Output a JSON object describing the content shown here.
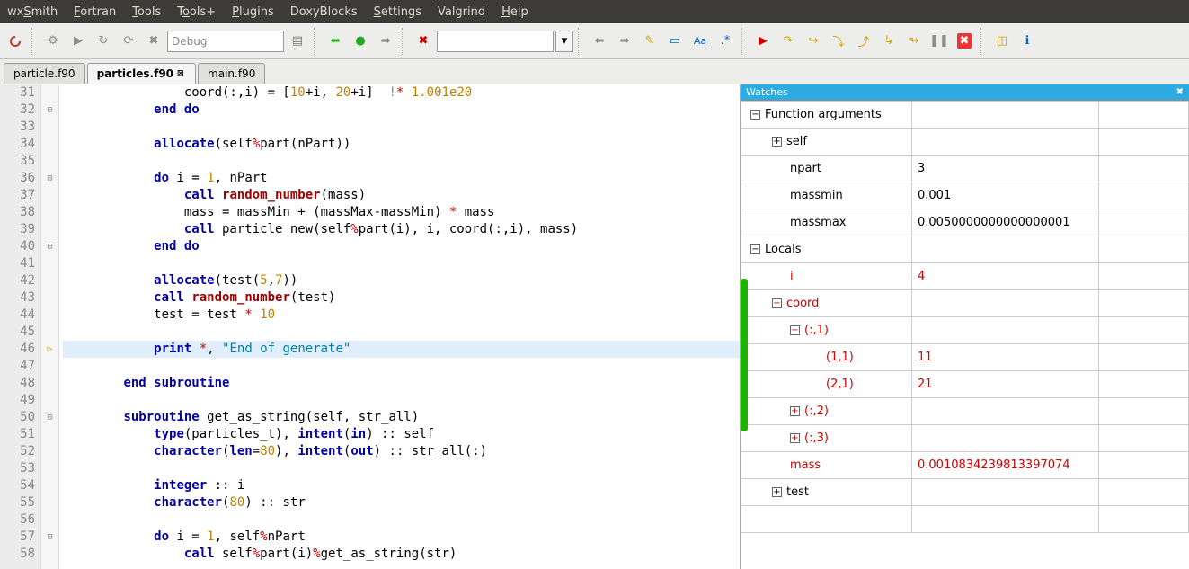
{
  "menu": [
    "wxSmith",
    "Fortran",
    "Tools",
    "Tools+",
    "Plugins",
    "DoxyBlocks",
    "Settings",
    "Valgrind",
    "Help"
  ],
  "menu_u": [
    2,
    0,
    0,
    1,
    0,
    -1,
    0,
    -1,
    0
  ],
  "toolbar": {
    "debug_config": "Debug"
  },
  "tabs": [
    {
      "label": "particle.f90",
      "active": false,
      "closable": false
    },
    {
      "label": "particles.f90",
      "active": true,
      "closable": true
    },
    {
      "label": "main.f90",
      "active": false,
      "closable": false
    }
  ],
  "editor": {
    "first_line": 31,
    "current_line": 46,
    "fold": {
      "32": "⊟",
      "36": "⊟",
      "40": "⊟",
      "50": "⊟",
      "57": "⊟",
      "46": "▷"
    },
    "lines": [
      "                coord(:,i) = [10+i, 20+i]  !* 1.001e20",
      "            end do",
      "",
      "            allocate(self%part(nPart))",
      "",
      "            do i = 1, nPart",
      "                call random_number(mass)",
      "                mass = massMin + (massMax-massMin) * mass",
      "                call particle_new(self%part(i), i, coord(:,i), mass)",
      "            end do",
      "",
      "            allocate(test(5,7))",
      "            call random_number(test)",
      "            test = test * 10",
      "",
      "            print *, \"End of generate\"",
      "",
      "        end subroutine",
      "",
      "        subroutine get_as_string(self, str_all)",
      "            type(particles_t), intent(in) :: self",
      "            character(len=80), intent(out) :: str_all(:)",
      "",
      "            integer :: i",
      "            character(80) :: str",
      "",
      "            do i = 1, self%nPart",
      "                call self%part(i)%get_as_string(str)"
    ]
  },
  "watches": {
    "title": "Watches",
    "rows": [
      {
        "exp": "-",
        "name": "Function arguments",
        "val": "",
        "ind": 0,
        "red": false
      },
      {
        "exp": "+",
        "name": "self",
        "val": "",
        "ind": 1,
        "red": false
      },
      {
        "exp": "",
        "name": "npart",
        "val": "3",
        "ind": 2,
        "red": false
      },
      {
        "exp": "",
        "name": "massmin",
        "val": "0.001",
        "ind": 2,
        "red": false
      },
      {
        "exp": "",
        "name": "massmax",
        "val": "0.0050000000000000001",
        "ind": 2,
        "red": false
      },
      {
        "exp": "-",
        "name": "Locals",
        "val": "",
        "ind": 0,
        "red": false
      },
      {
        "exp": "",
        "name": "i",
        "val": "4",
        "ind": 2,
        "red": true
      },
      {
        "exp": "-",
        "name": "coord",
        "val": "",
        "ind": 1,
        "red": true
      },
      {
        "exp": "-",
        "name": "(:,1)",
        "val": "",
        "ind": 2,
        "red": true
      },
      {
        "exp": "",
        "name": "(1,1)",
        "val": "11",
        "ind": 4,
        "red": true
      },
      {
        "exp": "",
        "name": "(2,1)",
        "val": "21",
        "ind": 4,
        "red": true
      },
      {
        "exp": "+",
        "name": "(:,2)",
        "val": "",
        "ind": 2,
        "red": true
      },
      {
        "exp": "+",
        "name": "(:,3)",
        "val": "",
        "ind": 2,
        "red": true
      },
      {
        "exp": "",
        "name": "mass",
        "val": "0.0010834239813397074",
        "ind": 2,
        "red": true
      },
      {
        "exp": "+",
        "name": "test",
        "val": "",
        "ind": 1,
        "red": false
      },
      {
        "exp": "",
        "name": "",
        "val": "",
        "ind": 1,
        "red": false
      }
    ]
  }
}
